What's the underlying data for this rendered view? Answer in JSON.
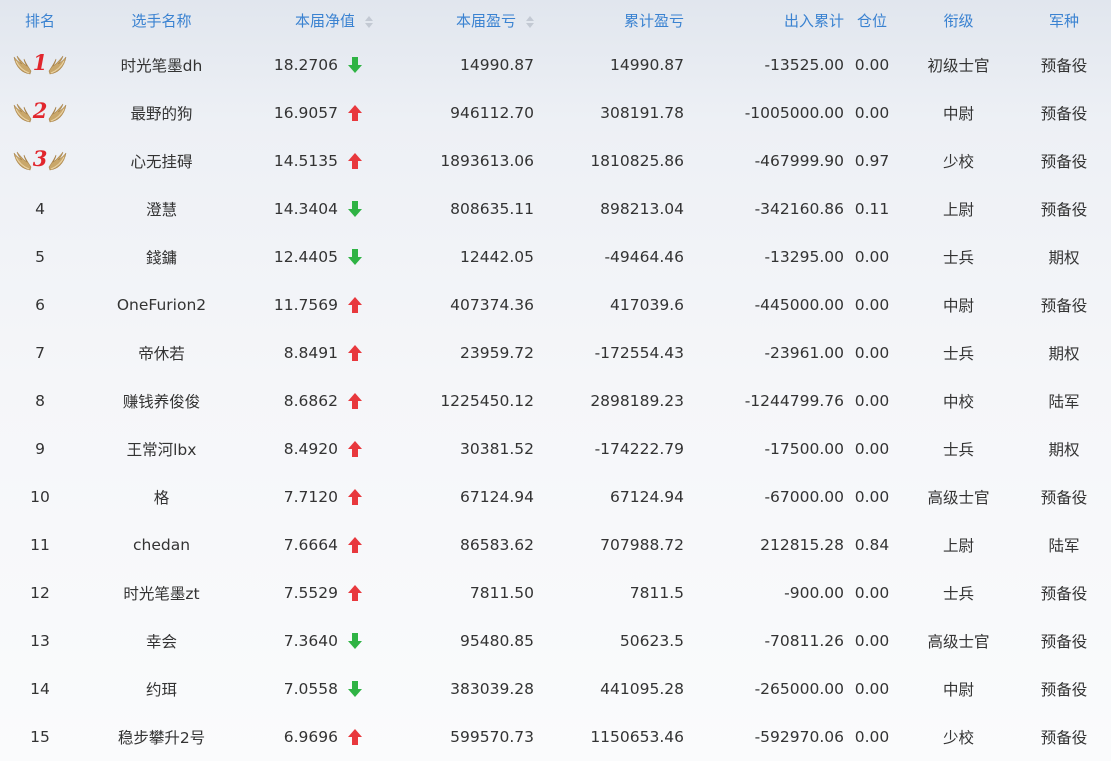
{
  "columns": {
    "rank": "排名",
    "name": "选手名称",
    "nav": "本届净值",
    "pl": "本届盈亏",
    "cum_pl": "累计盈亏",
    "flow": "出入累计",
    "position": "仓位",
    "rank_title": "衔级",
    "arm": "军种"
  },
  "colors": {
    "header_text": "#3a82d1",
    "up_arrow": "#e8383d",
    "down_arrow": "#2fb344",
    "medal_number": "#e1262d",
    "wing": "#c9a76a"
  },
  "rows": [
    {
      "rank": "1",
      "medal": true,
      "name": "时光笔墨dh",
      "nav": "18.2706",
      "trend": "down",
      "trend_icon": "down-arrow-icon",
      "pl": "14990.87",
      "cum_pl": "14990.87",
      "flow": "-13525.00",
      "position": "0.00",
      "rank_title": "初级士官",
      "arm": "预备役"
    },
    {
      "rank": "2",
      "medal": true,
      "name": "最野的狗",
      "nav": "16.9057",
      "trend": "up",
      "trend_icon": "up-arrow-icon",
      "pl": "946112.70",
      "cum_pl": "308191.78",
      "flow": "-1005000.00",
      "position": "0.00",
      "rank_title": "中尉",
      "arm": "预备役"
    },
    {
      "rank": "3",
      "medal": true,
      "name": "心无挂碍",
      "nav": "14.5135",
      "trend": "up",
      "trend_icon": "up-arrow-icon",
      "pl": "1893613.06",
      "cum_pl": "1810825.86",
      "flow": "-467999.90",
      "position": "0.97",
      "rank_title": "少校",
      "arm": "预备役"
    },
    {
      "rank": "4",
      "medal": false,
      "name": "澄慧",
      "nav": "14.3404",
      "trend": "down",
      "trend_icon": "down-arrow-icon",
      "pl": "808635.11",
      "cum_pl": "898213.04",
      "flow": "-342160.86",
      "position": "0.11",
      "rank_title": "上尉",
      "arm": "预备役"
    },
    {
      "rank": "5",
      "medal": false,
      "name": "錢鏞",
      "nav": "12.4405",
      "trend": "down",
      "trend_icon": "down-arrow-icon",
      "pl": "12442.05",
      "cum_pl": "-49464.46",
      "flow": "-13295.00",
      "position": "0.00",
      "rank_title": "士兵",
      "arm": "期权"
    },
    {
      "rank": "6",
      "medal": false,
      "name": "OneFurion2",
      "nav": "11.7569",
      "trend": "up",
      "trend_icon": "up-arrow-icon",
      "pl": "407374.36",
      "cum_pl": "417039.6",
      "flow": "-445000.00",
      "position": "0.00",
      "rank_title": "中尉",
      "arm": "预备役"
    },
    {
      "rank": "7",
      "medal": false,
      "name": "帝休若",
      "nav": "8.8491",
      "trend": "up",
      "trend_icon": "up-arrow-icon",
      "pl": "23959.72",
      "cum_pl": "-172554.43",
      "flow": "-23961.00",
      "position": "0.00",
      "rank_title": "士兵",
      "arm": "期权"
    },
    {
      "rank": "8",
      "medal": false,
      "name": "赚钱养俊俊",
      "nav": "8.6862",
      "trend": "up",
      "trend_icon": "up-arrow-icon",
      "pl": "1225450.12",
      "cum_pl": "2898189.23",
      "flow": "-1244799.76",
      "position": "0.00",
      "rank_title": "中校",
      "arm": "陆军"
    },
    {
      "rank": "9",
      "medal": false,
      "name": "王常河lbx",
      "nav": "8.4920",
      "trend": "up",
      "trend_icon": "up-arrow-icon",
      "pl": "30381.52",
      "cum_pl": "-174222.79",
      "flow": "-17500.00",
      "position": "0.00",
      "rank_title": "士兵",
      "arm": "期权"
    },
    {
      "rank": "10",
      "medal": false,
      "name": "格",
      "nav": "7.7120",
      "trend": "up",
      "trend_icon": "up-arrow-icon",
      "pl": "67124.94",
      "cum_pl": "67124.94",
      "flow": "-67000.00",
      "position": "0.00",
      "rank_title": "高级士官",
      "arm": "预备役"
    },
    {
      "rank": "11",
      "medal": false,
      "name": "chedan",
      "nav": "7.6664",
      "trend": "up",
      "trend_icon": "up-arrow-icon",
      "pl": "86583.62",
      "cum_pl": "707988.72",
      "flow": "212815.28",
      "position": "0.84",
      "rank_title": "上尉",
      "arm": "陆军"
    },
    {
      "rank": "12",
      "medal": false,
      "name": "时光笔墨zt",
      "nav": "7.5529",
      "trend": "up",
      "trend_icon": "up-arrow-icon",
      "pl": "7811.50",
      "cum_pl": "7811.5",
      "flow": "-900.00",
      "position": "0.00",
      "rank_title": "士兵",
      "arm": "预备役"
    },
    {
      "rank": "13",
      "medal": false,
      "name": "幸会",
      "nav": "7.3640",
      "trend": "down",
      "trend_icon": "down-arrow-icon",
      "pl": "95480.85",
      "cum_pl": "50623.5",
      "flow": "-70811.26",
      "position": "0.00",
      "rank_title": "高级士官",
      "arm": "预备役"
    },
    {
      "rank": "14",
      "medal": false,
      "name": "约珥",
      "nav": "7.0558",
      "trend": "down",
      "trend_icon": "down-arrow-icon",
      "pl": "383039.28",
      "cum_pl": "441095.28",
      "flow": "-265000.00",
      "position": "0.00",
      "rank_title": "中尉",
      "arm": "预备役"
    },
    {
      "rank": "15",
      "medal": false,
      "name": "稳步攀升2号",
      "nav": "6.9696",
      "trend": "up",
      "trend_icon": "up-arrow-icon",
      "pl": "599570.73",
      "cum_pl": "1150653.46",
      "flow": "-592970.06",
      "position": "0.00",
      "rank_title": "少校",
      "arm": "预备役"
    }
  ]
}
